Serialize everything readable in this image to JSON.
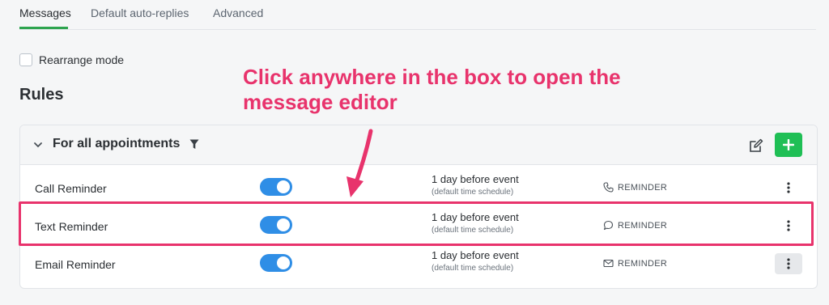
{
  "tabs": [
    {
      "label": "Messages",
      "active": true
    },
    {
      "label": "Default auto-replies",
      "active": false
    },
    {
      "label": "Advanced",
      "active": false
    }
  ],
  "rearrange_label": "Rearrange mode",
  "rearrange_checked": false,
  "section_title": "Rules",
  "callout_text": "Click anywhere in the box to open the message editor",
  "group": {
    "title": "For all appointments",
    "icons": {
      "collapse": "chevron-down-icon",
      "filter": "filter-icon",
      "edit": "edit-icon",
      "add": "plus-icon"
    }
  },
  "rules": [
    {
      "name": "Call Reminder",
      "enabled": true,
      "timing": "1 day before event",
      "timing_note": "(default time schedule)",
      "type_icon": "phone-icon",
      "type": "REMINDER"
    },
    {
      "name": "Text Reminder",
      "enabled": true,
      "timing": "1 day before event",
      "timing_note": "(default time schedule)",
      "type_icon": "chat-bubble-icon",
      "type": "REMINDER"
    },
    {
      "name": "Email Reminder",
      "enabled": true,
      "timing": "1 day before event",
      "timing_note": "(default time schedule)",
      "type_icon": "envelope-icon",
      "type": "REMINDER"
    }
  ],
  "colors": {
    "accent": "#1fbf55",
    "toggle_on": "#2f8ee6",
    "callout": "#e8336c",
    "tab_underline": "#2ea44f"
  }
}
